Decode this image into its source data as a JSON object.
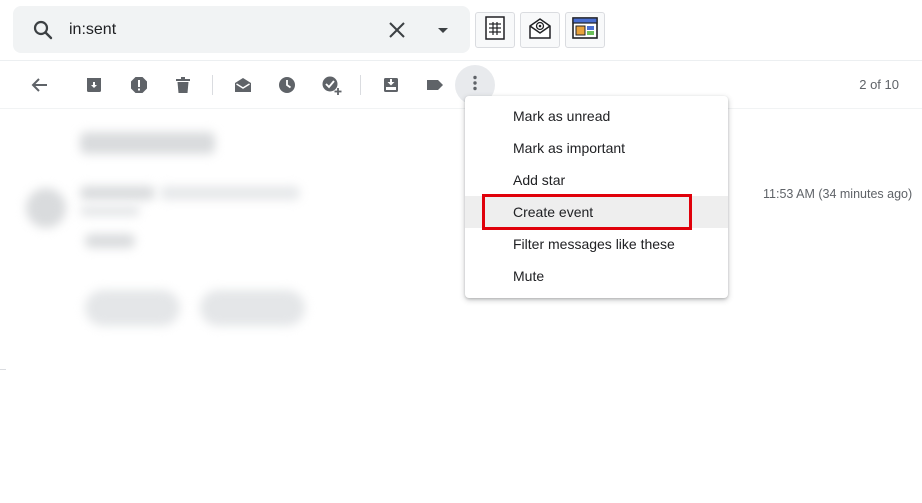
{
  "search": {
    "query": "in:sent"
  },
  "toolbar": {
    "pager": "2 of 10"
  },
  "message": {
    "timestamp": "11:53 AM (34 minutes ago)"
  },
  "menu": {
    "items": [
      {
        "label": "Mark as unread"
      },
      {
        "label": "Mark as important"
      },
      {
        "label": "Add star"
      },
      {
        "label": "Create event"
      },
      {
        "label": "Filter messages like these"
      },
      {
        "label": "Mute"
      }
    ],
    "highlighted_index": 3
  },
  "colors": {
    "accent_highlight": "#e0000a",
    "icon_gray": "#5f6368",
    "search_bg": "#f1f3f4"
  },
  "icons": {
    "search": "search-icon",
    "clear": "close-icon",
    "options": "caret-down-icon",
    "addons": [
      "spreadsheet-icon",
      "mail-at-icon",
      "window-layout-icon"
    ],
    "toolbar": [
      "back-arrow-icon",
      "archive-icon",
      "report-spam-icon",
      "delete-icon",
      "mark-read-icon",
      "snooze-icon",
      "add-task-icon",
      "move-to-icon",
      "label-icon",
      "more-vert-icon"
    ]
  }
}
